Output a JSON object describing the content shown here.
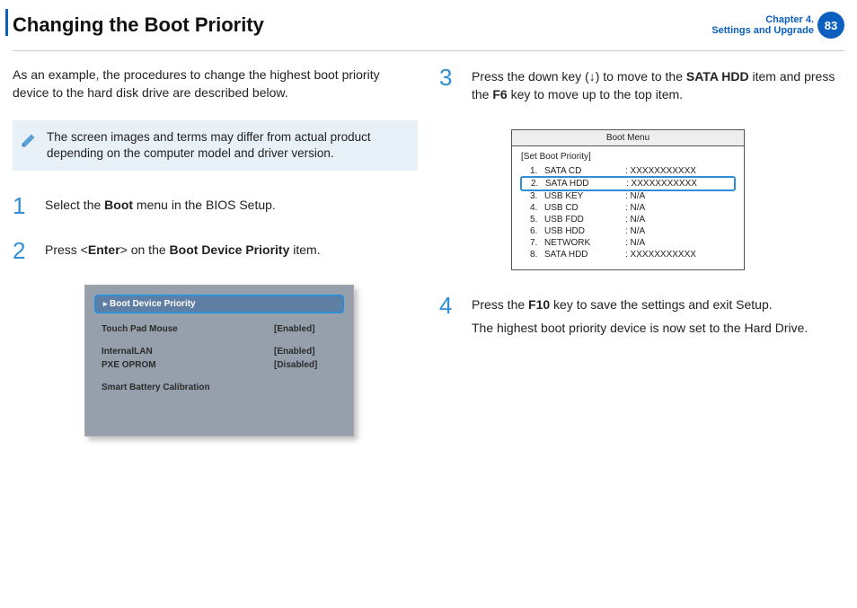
{
  "header": {
    "title": "Changing the Boot Priority",
    "chapter_line1": "Chapter 4.",
    "chapter_line2": "Settings and Upgrade",
    "page_number": "83"
  },
  "intro": "As an example, the procedures to change the highest boot priority device to the hard disk drive are described below.",
  "note": "The screen images and terms may differ from actual product depending on the computer model and driver version.",
  "steps": {
    "s1_a": "Select the ",
    "s1_b": "Boot",
    "s1_c": " menu in the BIOS Setup.",
    "s2_a": "Press <",
    "s2_b": "Enter",
    "s2_c": "> on the ",
    "s2_d": "Boot Device Priority",
    "s2_e": " item.",
    "s3_a": "Press the down key (↓) to move to the ",
    "s3_b": "SATA HDD",
    "s3_c": " item and press the ",
    "s3_d": "F6",
    "s3_e": " key to move up to the top item.",
    "s4_a": "Press the ",
    "s4_b": "F10",
    "s4_c": " key to save the settings and exit Setup.",
    "s4_line2": "The highest boot priority device is now set to the Hard Drive."
  },
  "bios_panel": {
    "highlight": "Boot Device Priority",
    "rows": [
      {
        "label": "Touch Pad Mouse",
        "value": "[Enabled]"
      },
      {
        "label": "InternalLAN",
        "value": "[Enabled]"
      },
      {
        "label": "PXE OPROM",
        "value": "[Disabled]"
      },
      {
        "label": "Smart Battery Calibration",
        "value": ""
      }
    ]
  },
  "boot_menu": {
    "title": "Boot Menu",
    "subtitle": "[Set Boot Priority]",
    "items": [
      {
        "n": "1.",
        "name": "SATA CD",
        "val": ": XXXXXXXXXXX",
        "sel": false
      },
      {
        "n": "2.",
        "name": "SATA HDD",
        "val": ": XXXXXXXXXXX",
        "sel": true
      },
      {
        "n": "3.",
        "name": "USB KEY",
        "val": ": N/A",
        "sel": false
      },
      {
        "n": "4.",
        "name": "USB CD",
        "val": ": N/A",
        "sel": false
      },
      {
        "n": "5.",
        "name": "USB FDD",
        "val": ": N/A",
        "sel": false
      },
      {
        "n": "6.",
        "name": "USB HDD",
        "val": ": N/A",
        "sel": false
      },
      {
        "n": "7.",
        "name": "NETWORK",
        "val": ": N/A",
        "sel": false
      },
      {
        "n": "8.",
        "name": "SATA HDD",
        "val": ": XXXXXXXXXXX",
        "sel": false
      }
    ]
  }
}
